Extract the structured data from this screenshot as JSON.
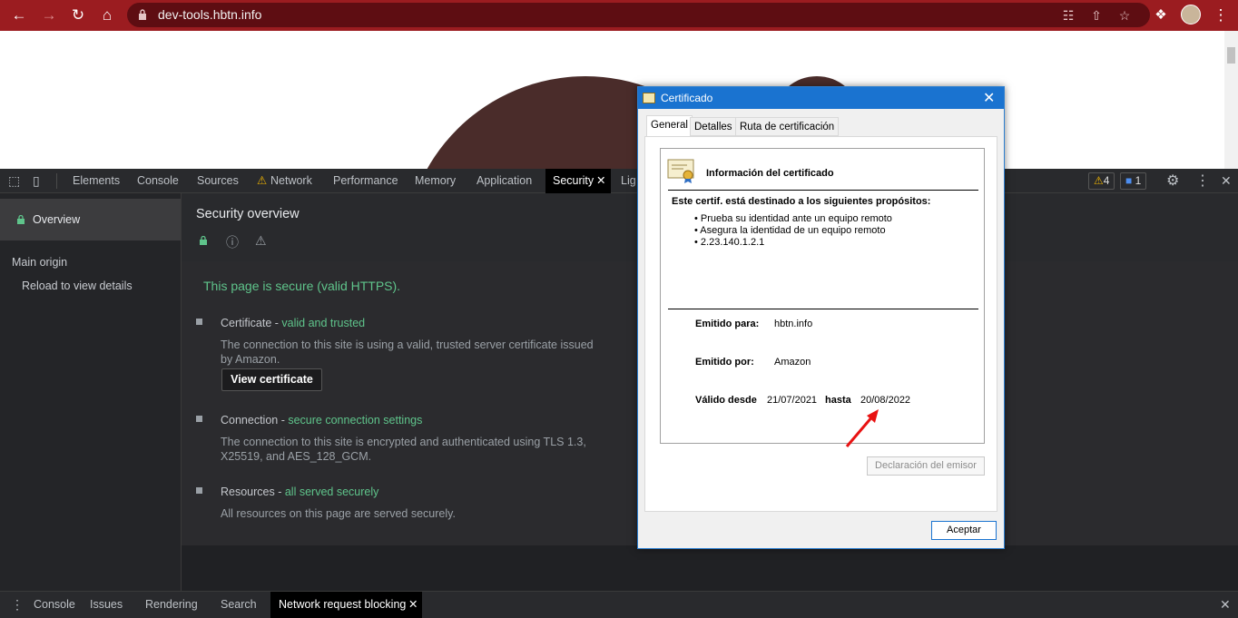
{
  "browser": {
    "url": "dev-tools.hbtn.info",
    "icons": [
      "back-icon",
      "forward-icon",
      "reload-icon",
      "home-icon",
      "lock-icon",
      "translate-icon",
      "share-icon",
      "star-icon",
      "extensions-icon",
      "menu-icon"
    ]
  },
  "devtools": {
    "tabs": [
      "Elements",
      "Console",
      "Sources",
      "Network",
      "Performance",
      "Memory",
      "Application",
      "Security",
      "Lig"
    ],
    "active_tab": "Security",
    "warnings_count": "4",
    "issues_count": "1"
  },
  "sidebar": {
    "overview": "Overview",
    "main_origin": "Main origin",
    "reload_hint": "Reload to view details"
  },
  "security": {
    "title": "Security overview",
    "summary": "This page is secure (valid HTTPS).",
    "certificate": {
      "label": "Certificate - ",
      "status": "valid and trusted",
      "desc1": "The connection to this site is using a valid, trusted server certificate issued",
      "desc2": "by Amazon.",
      "button": "View certificate"
    },
    "connection": {
      "label": "Connection - ",
      "status": "secure connection settings",
      "desc1": "The connection to this site is encrypted and authenticated using TLS 1.3,",
      "desc2": "X25519, and AES_128_GCM."
    },
    "resources": {
      "label": "Resources - ",
      "status": "all served securely",
      "desc": "All resources on this page are served securely."
    }
  },
  "drawer": {
    "tabs": [
      "Console",
      "Issues",
      "Rendering",
      "Search",
      "Network request blocking"
    ]
  },
  "dialog": {
    "title": "Certificado",
    "tabs": [
      "General",
      "Detalles",
      "Ruta de certificación"
    ],
    "info_title": "Información del certificado",
    "purpose_heading": "Este certif. está destinado a los siguientes propósitos:",
    "purposes": [
      "• Prueba su identidad ante un equipo remoto",
      "• Asegura la identidad de un equipo remoto",
      "• 2.23.140.1.2.1"
    ],
    "issued_to_label": "Emitido para:",
    "issued_to": "hbtn.info",
    "issued_by_label": "Emitido por:",
    "issued_by": "Amazon",
    "valid_from_label": "Válido desde",
    "valid_from": "21/07/2021",
    "valid_to_label": "hasta",
    "valid_to": "20/08/2022",
    "issuer_statement": "Declaración del emisor",
    "ok": "Aceptar"
  },
  "colors": {
    "browser_bar": "#9b1c20",
    "accent_green": "#5fc48b",
    "dialog_title": "#1a73d0",
    "arrow": "#e81212"
  }
}
